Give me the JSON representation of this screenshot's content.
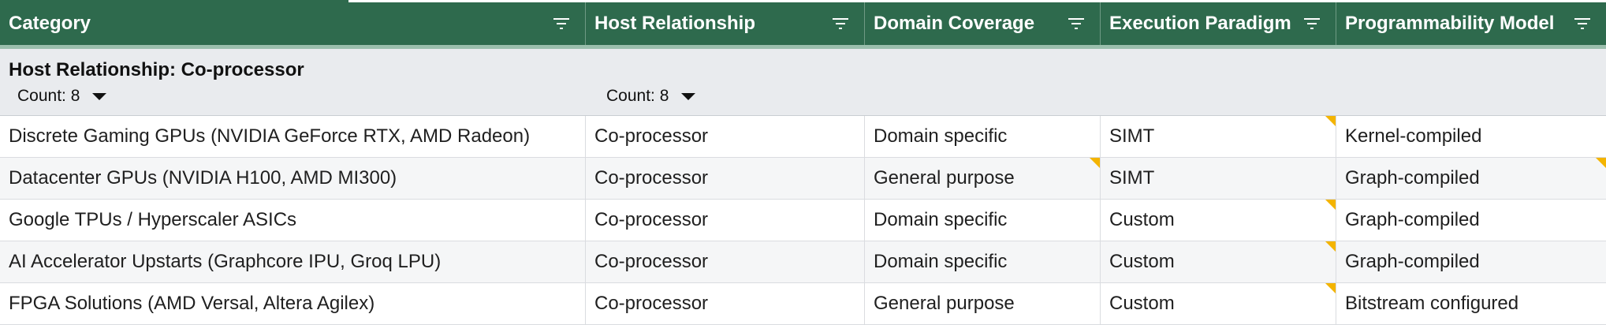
{
  "header": {
    "columns": [
      {
        "label": "Category",
        "icon": "filter-icon"
      },
      {
        "label": "Host Relationship",
        "icon": "filter-icon"
      },
      {
        "label": "Domain Coverage",
        "icon": "filter-icon"
      },
      {
        "label": "Execution Paradigm",
        "icon": "filter-icon"
      },
      {
        "label": "Programmability Model",
        "icon": "filter-icon"
      }
    ]
  },
  "group": {
    "title": "Host Relationship: Co-processor",
    "counts": [
      "Count: 8",
      "Count: 8"
    ]
  },
  "rows": [
    {
      "category": "Discrete Gaming GPUs (NVIDIA GeForce RTX, AMD Radeon)",
      "host": "Co-processor",
      "domain": "Domain specific",
      "execution": "SIMT",
      "programmability": "Kernel-compiled"
    },
    {
      "category": "Datacenter GPUs (NVIDIA H100, AMD MI300)",
      "host": "Co-processor",
      "domain": "General purpose",
      "execution": "SIMT",
      "programmability": "Graph-compiled"
    },
    {
      "category": "Google TPUs / Hyperscaler ASICs",
      "host": "Co-processor",
      "domain": "Domain specific",
      "execution": "Custom",
      "programmability": "Graph-compiled"
    },
    {
      "category": "AI Accelerator Upstarts (Graphcore IPU, Groq LPU)",
      "host": "Co-processor",
      "domain": "Domain specific",
      "execution": "Custom",
      "programmability": "Graph-compiled"
    },
    {
      "category": "FPGA Solutions (AMD Versal, Altera Agilex)",
      "host": "Co-processor",
      "domain": "General purpose",
      "execution": "Custom",
      "programmability": "Bitstream configured"
    }
  ],
  "colors": {
    "header_bg": "#2e6a4d",
    "group_bg": "#e9ebee",
    "note_marker": "#f4b400"
  }
}
